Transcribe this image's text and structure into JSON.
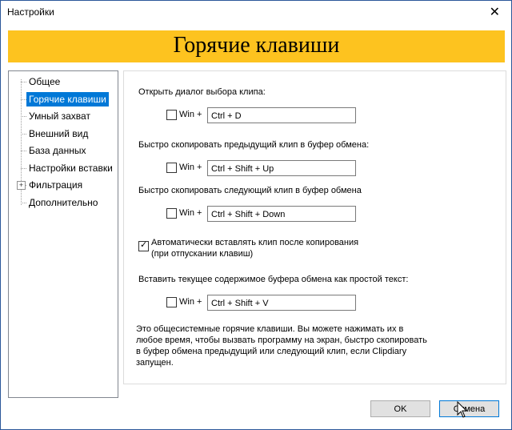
{
  "window": {
    "title": "Настройки"
  },
  "banner": {
    "title": "Горячие клавиши"
  },
  "tree": {
    "items": [
      {
        "label": "Общее"
      },
      {
        "label": "Горячие клавиши"
      },
      {
        "label": "Умный захват"
      },
      {
        "label": "Внешний вид"
      },
      {
        "label": "База данных"
      },
      {
        "label": "Настройки вставки"
      },
      {
        "label": "Фильтрация"
      },
      {
        "label": "Дополнительно"
      }
    ],
    "selected": "Горячие клавиши"
  },
  "hotkeys": {
    "win_label": "Win +",
    "open_dialog": {
      "label": "Открыть диалог выбора клипа:",
      "win_checked": false,
      "value": "Ctrl + D"
    },
    "copy_prev": {
      "label": "Быстро скопировать предыдущий клип в буфер обмена:",
      "win_checked": false,
      "value": "Ctrl + Shift + Up"
    },
    "copy_next": {
      "label": "Быстро скопировать следующий клип в буфер обмена",
      "win_checked": false,
      "value": "Ctrl + Shift + Down"
    },
    "auto_paste": {
      "line1": "Автоматически вставлять клип после копирования",
      "line2": "(при отпускании клавиш)",
      "checked": true
    },
    "paste_plain": {
      "label": "Вставить текущее содержимое буфера обмена как простой текст:",
      "win_checked": false,
      "value": "Ctrl + Shift + V"
    },
    "info": {
      "line1": "Это общесистемные горячие клавиши. Вы можете нажимать их в",
      "line2": "любое время, чтобы вызвать программу на экран, быстро скопировать",
      "line3": "в буфер обмена предыдущий или следующий клип, если Clipdiary",
      "line4": "запущен."
    }
  },
  "buttons": {
    "ok": "OK",
    "cancel": "Отмена"
  }
}
